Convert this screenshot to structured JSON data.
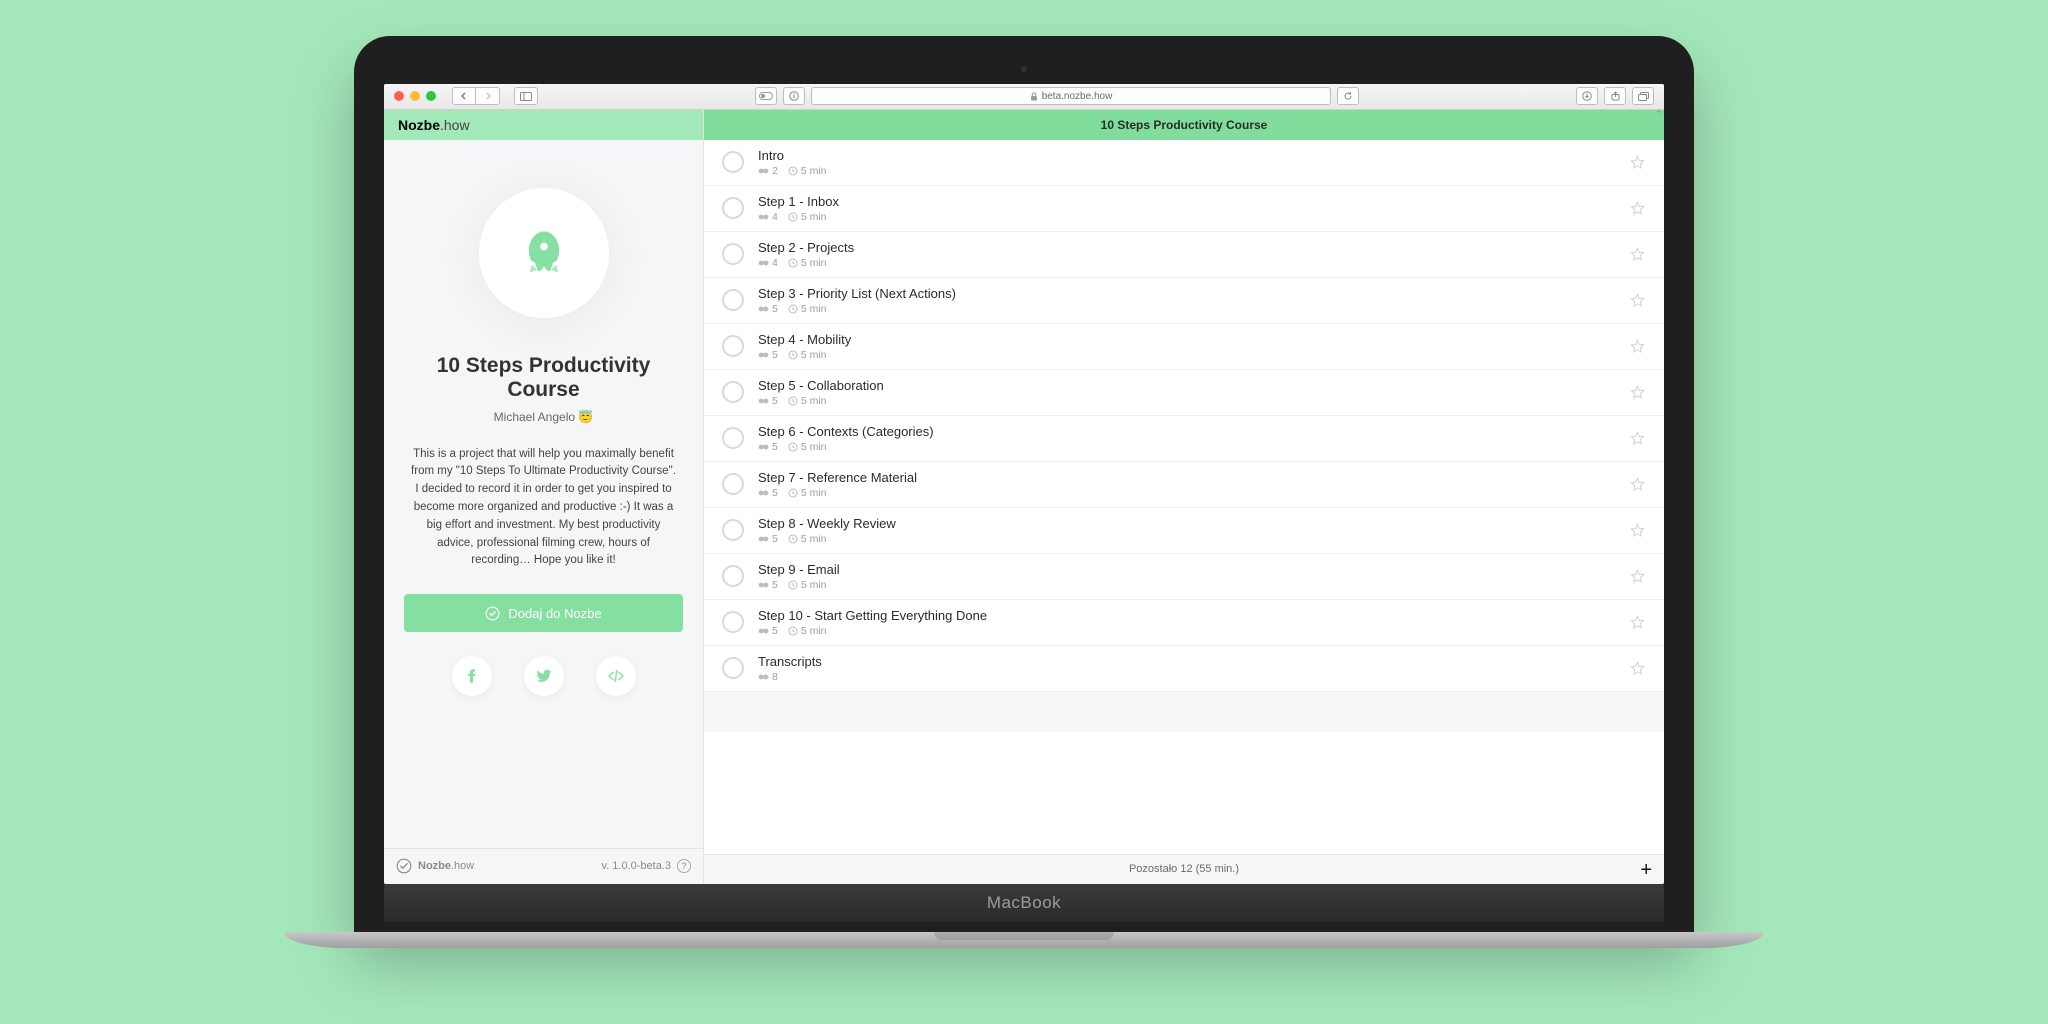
{
  "browser": {
    "url": "beta.nozbe.how"
  },
  "brand": {
    "prefix": "Nozbe",
    "suffix": ".how"
  },
  "sidebar": {
    "project_title": "10 Steps Productivity Course",
    "author": "Michael Angelo 😇",
    "description": "This is a project that will help you maximally benefit from my \"10 Steps To Ultimate Productivity Course\". I decided to record it in order to get you inspired to become more organized and productive :-) It was a big effort and investment. My best productivity advice, professional filming crew, hours of recording… Hope you like it!",
    "cta_label": "Dodaj do Nozbe",
    "version": "v. 1.0.0-beta.3"
  },
  "content": {
    "header_title": "10 Steps Productivity Course",
    "footer_text": "Pozostało 12  (55 min.)",
    "tasks": [
      {
        "title": "Intro",
        "comments": "2",
        "time": "5 min"
      },
      {
        "title": "Step 1 - Inbox",
        "comments": "4",
        "time": "5 min"
      },
      {
        "title": "Step 2 - Projects",
        "comments": "4",
        "time": "5 min"
      },
      {
        "title": "Step 3 - Priority List (Next Actions)",
        "comments": "5",
        "time": "5 min"
      },
      {
        "title": "Step 4 - Mobility",
        "comments": "5",
        "time": "5 min"
      },
      {
        "title": "Step 5 - Collaboration",
        "comments": "5",
        "time": "5 min"
      },
      {
        "title": "Step 6 - Contexts (Categories)",
        "comments": "5",
        "time": "5 min"
      },
      {
        "title": "Step 7 - Reference Material",
        "comments": "5",
        "time": "5 min"
      },
      {
        "title": "Step 8 - Weekly Review",
        "comments": "5",
        "time": "5 min"
      },
      {
        "title": "Step 9 - Email",
        "comments": "5",
        "time": "5 min"
      },
      {
        "title": "Step 10 - Start Getting Everything Done",
        "comments": "5",
        "time": "5 min"
      },
      {
        "title": "Transcripts",
        "comments": "8",
        "time": ""
      }
    ]
  },
  "laptop_label": "MacBook"
}
